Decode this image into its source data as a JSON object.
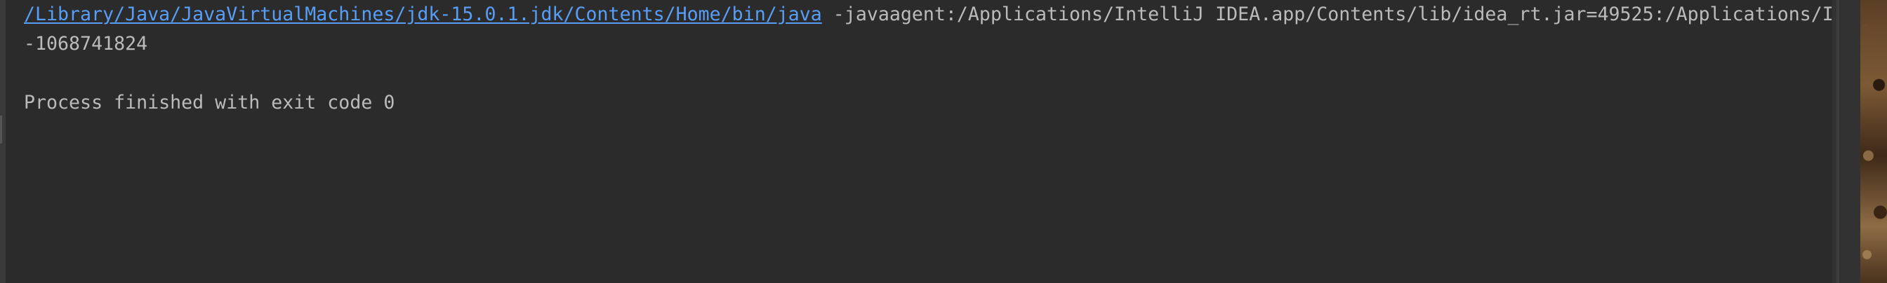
{
  "console": {
    "command_path": "/Library/Java/JavaVirtualMachines/jdk-15.0.1.jdk/Contents/Home/bin/java",
    "command_args": " -javaagent:/Applications/IntelliJ IDEA.app/Contents/lib/idea_rt.jar=49525:/Applications/I",
    "output_line": "-1068741824",
    "exit_message": "Process finished with exit code 0"
  },
  "colors": {
    "background": "#2b2b2b",
    "text": "#bbbbbb",
    "link": "#589df6"
  }
}
